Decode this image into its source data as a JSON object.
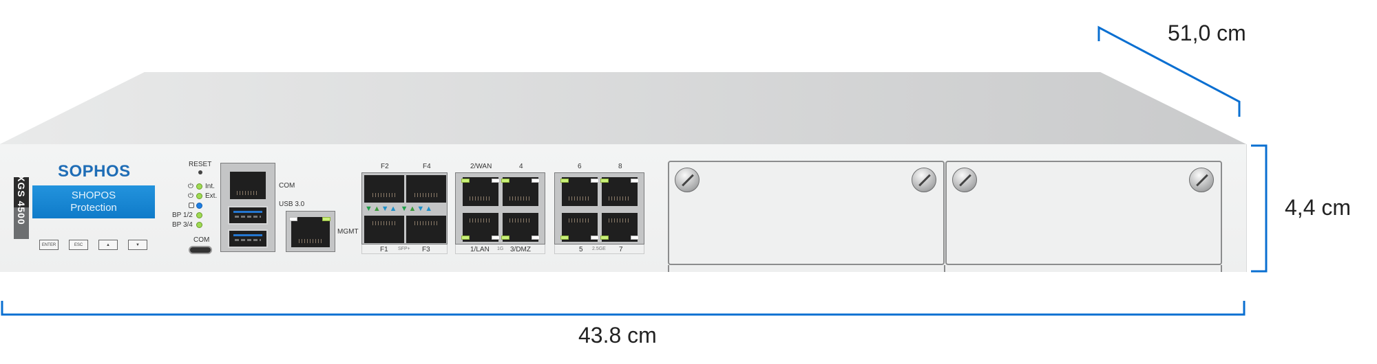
{
  "device": {
    "brand": "SOPHOS",
    "model_series": "XGS",
    "model_number": "4500",
    "lcd_lines": [
      "SHOPOS",
      "Protection"
    ],
    "keypad_buttons": [
      "ENTER",
      "ESC",
      "▲",
      "▼"
    ],
    "reset_label": "RESET",
    "status_leds": [
      {
        "label": "Int.",
        "icon": "power-icon",
        "color": "#9edb52"
      },
      {
        "label": "Ext.",
        "icon": "power-icon",
        "color": "#9edb52"
      },
      {
        "label": "",
        "icon": "disk-icon",
        "color": "#1d7ee3"
      },
      {
        "label": "BP 1/2",
        "icon": "",
        "color": "#9edb52"
      },
      {
        "label": "BP 3/4",
        "icon": "",
        "color": "#9edb52"
      }
    ],
    "com_micro_label": "COM",
    "com_rj45_label": "COM",
    "usb_label": "USB 3.0",
    "mgmt_label": "MGMT",
    "sfp_group": {
      "top_labels": [
        "F2",
        "F4"
      ],
      "bottom_labels": [
        "F1",
        "F3"
      ],
      "type_label": "SFP+"
    },
    "lan_group_1g": {
      "top_labels": [
        "2/WAN",
        "4"
      ],
      "bottom_labels": [
        "1/LAN",
        "3/DMZ"
      ],
      "type_label": "1G"
    },
    "lan_group_25g": {
      "top_labels": [
        "6",
        "8"
      ],
      "bottom_labels": [
        "5",
        "7"
      ],
      "type_label": "2.5GE"
    },
    "expansion_modules": 2
  },
  "dimensions": {
    "depth": "51,0 cm",
    "height": "4,4 cm",
    "width": "43.8 cm"
  },
  "colors": {
    "dimension_line": "#0a6fd1",
    "brand": "#1f6db6",
    "lcd": "#1488d6"
  }
}
